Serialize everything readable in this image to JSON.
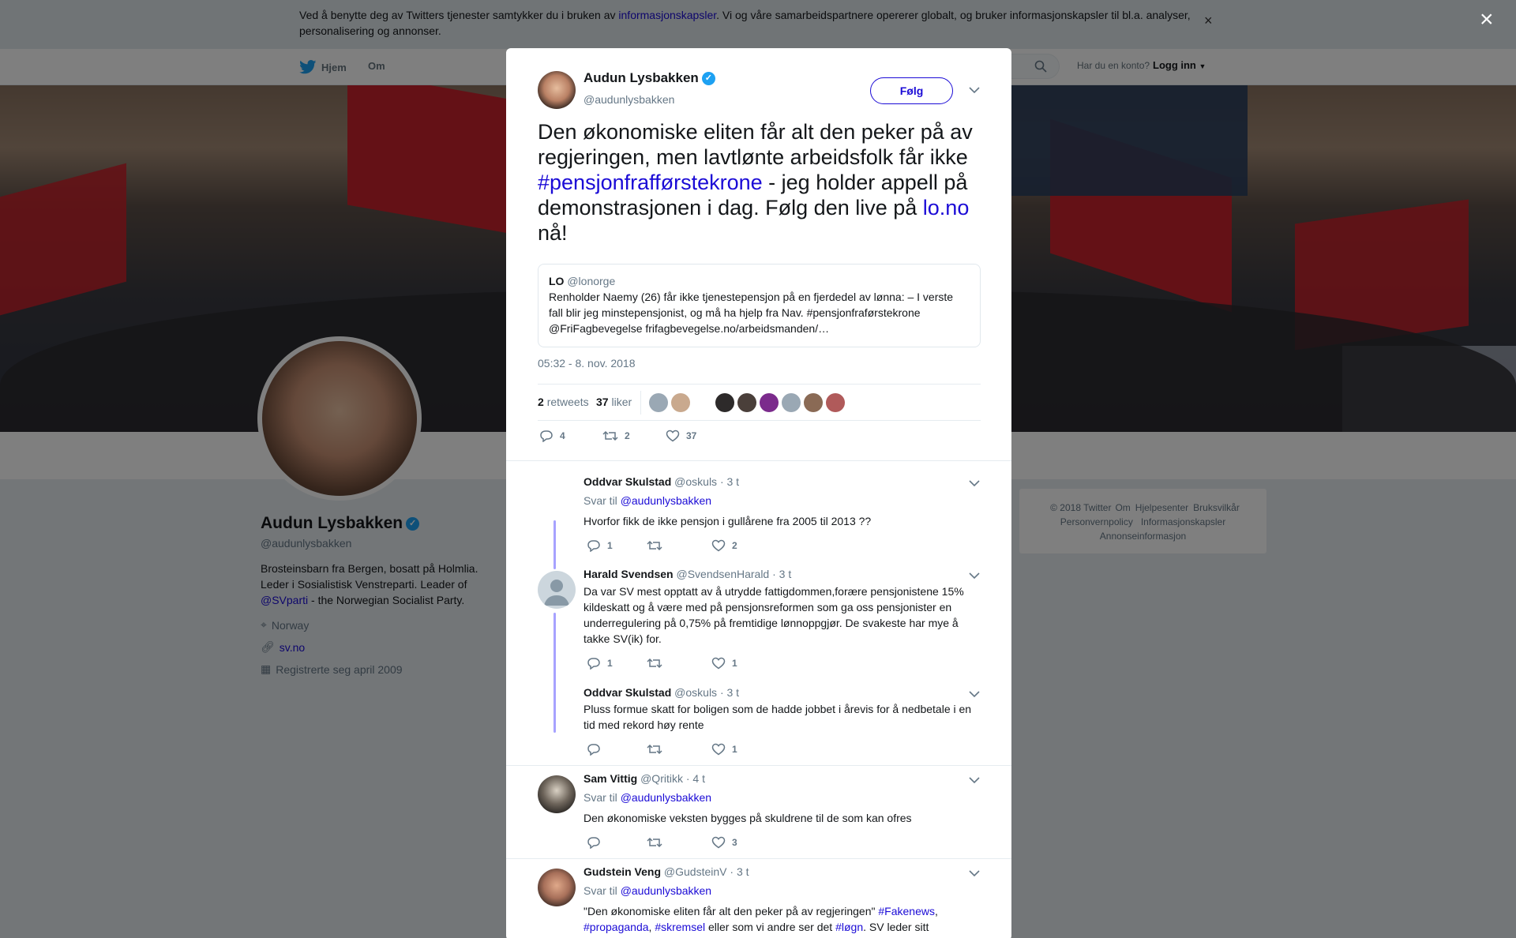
{
  "cookie": {
    "text_before": "Ved å benytte deg av Twitters tjenester samtykker du i bruken av ",
    "link": "informasjonskapsler",
    "text_after": ". Vi og våre samarbeidspartnere opererer globalt, og bruker informasjonskapsler til bl.a. analyser, personalisering og annonser.",
    "close": "×"
  },
  "nav": {
    "home": "Hjem",
    "about": "Om",
    "login_question": "Har du en konto?",
    "login": "Logg inn"
  },
  "profile": {
    "name": "Audun Lysbakken",
    "handle": "@audunlysbakken",
    "bio_1": "Brosteinsbarn fra Bergen, bosatt på Holmlia. Leder i Sosialistisk Venstreparti. Leader of ",
    "bio_link": "@SVparti",
    "bio_2": " - the Norwegian Socialist Party.",
    "location": "Norway",
    "website": "sv.no",
    "joined": "Registrerte seg april 2009"
  },
  "footer": [
    "© 2018 Twitter",
    "Om",
    "Hjelpesenter",
    "Bruksvilkår",
    "Personvernpolicy",
    "Informasjonskapsler",
    "Annonseinformasjon"
  ],
  "modal_close": "×",
  "tweet": {
    "name": "Audun Lysbakken",
    "handle": "@audunlysbakken",
    "follow": "Følg",
    "text_1": "Den økonomiske eliten får alt den peker på av regjeringen, men lavtlønte arbeidsfolk får ikke ",
    "hashtag": "#pensjonfrafførstekrone",
    "text_2": " - jeg holder appell på demonstrasjonen i dag. Følg den live på ",
    "link": "lo.no",
    "text_3": " nå!",
    "quote_name": "LO",
    "quote_handle": "@lonorge",
    "quote_text": "Renholder Naemy (26) får ikke tjenestepensjon på en fjerdedel av lønna: – I verste fall blir jeg minstepensjonist, og må ha hjelp fra Nav. #pensjonfraførstekrone @FriFagbevegelse frifagbevegelse.no/arbeidsmanden/…",
    "time": "05:32 - 8. nov. 2018",
    "retweets_count": "2",
    "retweets_label": "retweets",
    "likes_count": "37",
    "likes_label": "liker",
    "replies": "4",
    "retweets": "2",
    "likes": "37"
  },
  "replies": [
    {
      "name": "Oddvar Skulstad",
      "handle": "@oskuls",
      "time": "· 3 t",
      "to_label": "Svar til",
      "to": "@audunlysbakken",
      "text": "Hvorfor fikk de ikke pensjon i gullårene fra 2005 til 2013 ??",
      "replies": "1",
      "retweets": "",
      "likes": "2"
    },
    {
      "name": "Harald Svendsen",
      "handle": "@SvendsenHarald",
      "time": "· 3 t",
      "text": "Da var SV mest opptatt av å utrydde fattigdommen,forære pensjonistene 15% kildeskatt og å være med på pensjonsreformen som ga oss pensjonister en underregulering på 0,75% på fremtidige lønnoppgjør. De svakeste har mye å takke SV(ik) for.",
      "replies": "1",
      "retweets": "",
      "likes": "1"
    },
    {
      "name": "Oddvar Skulstad",
      "handle": "@oskuls",
      "time": "· 3 t",
      "text": "Pluss formue skatt for boligen som de hadde jobbet i årevis for å nedbetale i en tid med rekord høy rente",
      "replies": "",
      "retweets": "",
      "likes": "1"
    },
    {
      "name": "Sam Vittig",
      "handle": "@Qritikk",
      "time": "· 4 t",
      "to_label": "Svar til",
      "to": "@audunlysbakken",
      "text": "Den økonomiske veksten bygges på skuldrene til de som kan ofres",
      "replies": "",
      "retweets": "",
      "likes": "3"
    },
    {
      "name": "Gudstein Veng",
      "handle": "@GudsteinV",
      "time": "· 3 t",
      "to_label": "Svar til",
      "to": "@audunlysbakken",
      "text_1": "\"Den økonomiske eliten får alt den peker på av regjeringen\" ",
      "tag1": "#Fakenews",
      "sep1": ", ",
      "tag2": "#propaganda",
      "sep2": ", ",
      "tag3": "#skremsel",
      "mid": " eller som vi andre ser det ",
      "tag4": "#løgn",
      "end": ". SV leder sitt"
    }
  ],
  "colors": {
    "link": "#1b0bd6",
    "verified": "#1da1f2",
    "thread": "#a7a2ff",
    "flag": "#c8232c"
  }
}
